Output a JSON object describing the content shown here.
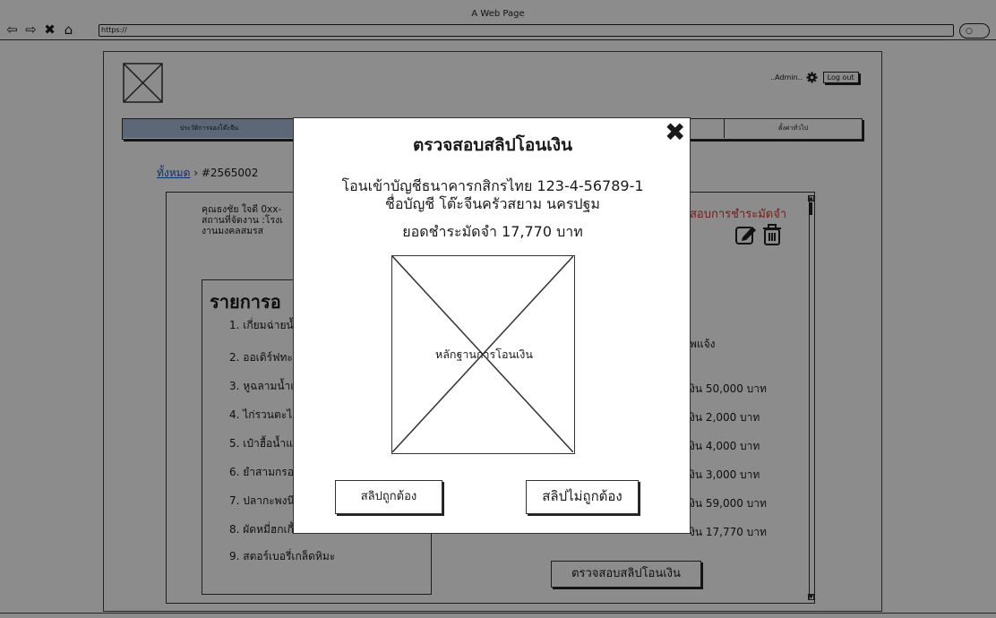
{
  "browser": {
    "window_title": "A Web Page",
    "url": "https://"
  },
  "header": {
    "admin_name": "..Admin..",
    "logout_label": "Log out"
  },
  "tabs": {
    "history_label": "ประวัติการจองโต๊ะจีน",
    "settings_label": "ตั้งค่าทั่วไป"
  },
  "breadcrumb": {
    "root": "ทั้งหมด",
    "separator": " › ",
    "current": "#2565002"
  },
  "customer": {
    "name_line": "คุณธงชัย ใจดี 0xx-",
    "venue_line": "สถานที่จัดงาน :โรงเ",
    "event_line": "งานมงคลสมรส"
  },
  "status": {
    "text": "สอบการชำระมัดจำ",
    "color": "#d23b32"
  },
  "order": {
    "title": "รายการอ",
    "items": [
      "1. เกี่ยมฉ่ายน้ำ",
      "2. ออเดิร์ฟทะ",
      "3. หูฉลามน้ำแ",
      "4. ไก่รวนตะไค",
      "5. เป๋าฮื้อน้ำแ",
      "6. ยำสามกรอ",
      "7. ปลากะพงนึ",
      "8. ผัดหมี่ฮกเกี้",
      "9. สตอร์เบอรี่เกล็ดหิมะ"
    ]
  },
  "note": "พแจ้ง",
  "prices": [
    "งิน 50,000 บาท",
    "งิน 2,000 บาท",
    "งิน 4,000 บาท",
    "งิน 3,000 บาท",
    "งิน 59,000 บาท",
    "งิน 17,770 บาท"
  ],
  "verify_button": "ตรวจสอบสลิปโอนเงิน",
  "modal": {
    "title": "ตรวจสอบสลิปโอนเงิน",
    "bank_line": "โอนเข้าบัญชีธนาคารกสิกรไทย 123-4-56789-1",
    "account_line": "ชื่อบัญชี โต๊ะจีนครัวสยาม นครปฐม",
    "deposit_line": "ยอดชำระมัดจำ 17,770 บาท",
    "slip_caption": "หลักฐานการโอนเงิน",
    "correct_button": "สลิปถูกต้อง",
    "incorrect_button": "สลิปไม่ถูกต้อง"
  }
}
